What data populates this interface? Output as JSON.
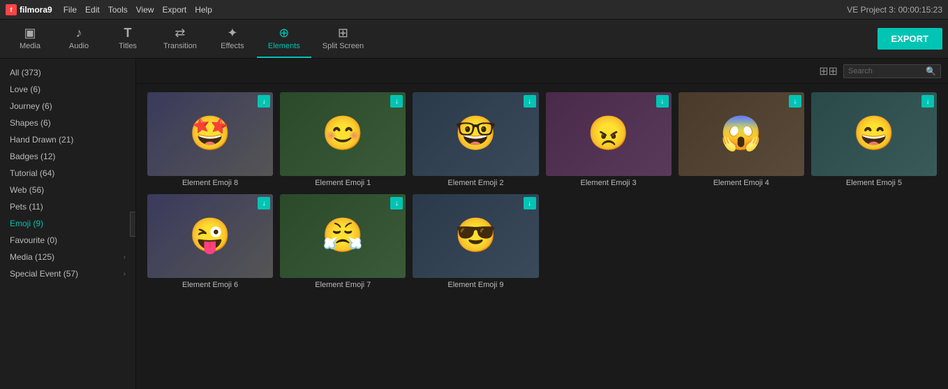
{
  "menubar": {
    "logo": "filmora9",
    "logo_icon": "f",
    "menu_items": [
      "File",
      "Edit",
      "Tools",
      "View",
      "Export",
      "Help"
    ],
    "project_info": "VE Project 3:  00:00:15:23"
  },
  "toolbar": {
    "items": [
      {
        "id": "media",
        "label": "Media",
        "icon": "▣"
      },
      {
        "id": "audio",
        "label": "Audio",
        "icon": "♪"
      },
      {
        "id": "titles",
        "label": "Titles",
        "icon": "T"
      },
      {
        "id": "transition",
        "label": "Transition",
        "icon": "⇄"
      },
      {
        "id": "effects",
        "label": "Effects",
        "icon": "✦"
      },
      {
        "id": "elements",
        "label": "Elements",
        "icon": "⊕"
      },
      {
        "id": "splitscreen",
        "label": "Split Screen",
        "icon": "⊞"
      }
    ],
    "active": "elements",
    "export_label": "EXPORT"
  },
  "sidebar": {
    "items": [
      {
        "id": "all",
        "label": "All (373)",
        "active": false,
        "arrow": false
      },
      {
        "id": "love",
        "label": "Love (6)",
        "active": false,
        "arrow": false
      },
      {
        "id": "journey",
        "label": "Journey (6)",
        "active": false,
        "arrow": false
      },
      {
        "id": "shapes",
        "label": "Shapes (6)",
        "active": false,
        "arrow": false
      },
      {
        "id": "handdrawn",
        "label": "Hand Drawn (21)",
        "active": false,
        "arrow": false
      },
      {
        "id": "badges",
        "label": "Badges (12)",
        "active": false,
        "arrow": false
      },
      {
        "id": "tutorial",
        "label": "Tutorial (64)",
        "active": false,
        "arrow": false
      },
      {
        "id": "web",
        "label": "Web (56)",
        "active": false,
        "arrow": false
      },
      {
        "id": "pets",
        "label": "Pets (11)",
        "active": false,
        "arrow": false
      },
      {
        "id": "emoji",
        "label": "Emoji (9)",
        "active": true,
        "arrow": false
      },
      {
        "id": "favourite",
        "label": "Favourite (0)",
        "active": false,
        "arrow": false
      },
      {
        "id": "media",
        "label": "Media (125)",
        "active": false,
        "arrow": true
      },
      {
        "id": "specialevent",
        "label": "Special Event (57)",
        "active": false,
        "arrow": true
      }
    ]
  },
  "content": {
    "search_placeholder": "Search",
    "elements": [
      {
        "id": "emoji8",
        "name": "Element Emoji 8",
        "emoji": "🤩",
        "bg": "emoji-bg-1",
        "has_download": true
      },
      {
        "id": "emoji1",
        "name": "Element Emoji 1",
        "emoji": "😊",
        "bg": "emoji-bg-2",
        "has_download": true
      },
      {
        "id": "emoji2",
        "name": "Element Emoji 2",
        "emoji": "🤓",
        "bg": "emoji-bg-3",
        "has_download": true
      },
      {
        "id": "emoji3",
        "name": "Element Emoji 3",
        "emoji": "😠",
        "bg": "emoji-bg-4",
        "has_download": true
      },
      {
        "id": "emoji4",
        "name": "Element Emoji 4",
        "emoji": "😱",
        "bg": "emoji-bg-5",
        "has_download": true
      },
      {
        "id": "emoji5",
        "name": "Element Emoji 5",
        "emoji": "😄",
        "bg": "emoji-bg-6",
        "has_download": true
      },
      {
        "id": "emoji6",
        "name": "Element Emoji 6",
        "emoji": "😜",
        "bg": "emoji-bg-1",
        "has_download": true
      },
      {
        "id": "emoji7",
        "name": "Element Emoji 7",
        "emoji": "😤",
        "bg": "emoji-bg-2",
        "has_download": true
      },
      {
        "id": "emoji9",
        "name": "Element Emoji 9",
        "emoji": "😎",
        "bg": "emoji-bg-3",
        "has_download": true
      }
    ]
  },
  "icons": {
    "download": "↓",
    "grid": "⊞",
    "search": "🔍",
    "arrow_right": "›",
    "collapse": "‹"
  }
}
